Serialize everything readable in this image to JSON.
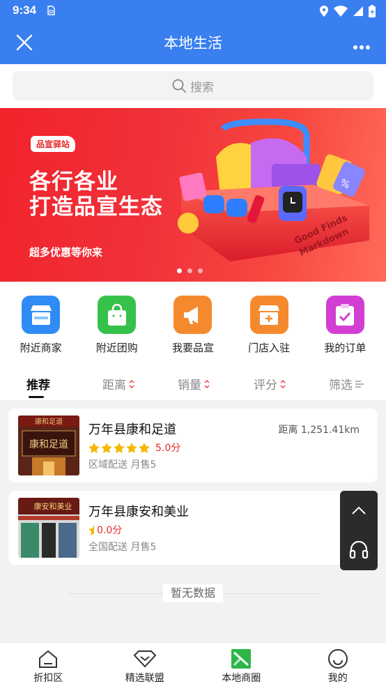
{
  "status_bar": {
    "time": "9:34"
  },
  "header": {
    "title": "本地生活"
  },
  "search": {
    "placeholder": "搜索"
  },
  "banner": {
    "tag": "品宣驿站",
    "headline_1": "各行各业",
    "headline_2": "打造品宣生态",
    "subtitle": "超多优惠等你来",
    "box_text_1": "Good Finds",
    "box_text_2": "Markdown",
    "tag_text": "%"
  },
  "quick_actions": [
    {
      "label": "附近商家",
      "icon": "storefront-icon",
      "color": "#2f8cf5"
    },
    {
      "label": "附近团购",
      "icon": "shopping-bag-icon",
      "color": "#36c24a"
    },
    {
      "label": "我要品宣",
      "icon": "megaphone-icon",
      "color": "#f5892e"
    },
    {
      "label": "门店入驻",
      "icon": "store-join-icon",
      "color": "#f5892e"
    },
    {
      "label": "我的订单",
      "icon": "order-icon",
      "color": "#d23ed4"
    }
  ],
  "sort_tabs": [
    {
      "label": "推荐",
      "active": true
    },
    {
      "label": "距离"
    },
    {
      "label": "销量"
    },
    {
      "label": "评分"
    },
    {
      "label": "筛选"
    }
  ],
  "stores": [
    {
      "name": "万年县康和足道",
      "rating_text": "5.0分",
      "stars": 5,
      "meta": "区域配送 月售5",
      "distance": "距离 1,251.41km",
      "sign_text": "康和足道",
      "sign_top": "康和足道"
    },
    {
      "name": "万年县康安和美业",
      "rating_text": "0.0分",
      "stars": 0,
      "meta": "全国配送 月售5",
      "distance": "",
      "sign_text": "康安和美业"
    }
  ],
  "empty_text": "暂无数据",
  "tab_bar": [
    {
      "label": "折扣区",
      "icon": "home-icon"
    },
    {
      "label": "精选联盟",
      "icon": "diamond-icon"
    },
    {
      "label": "本地商圈",
      "icon": "local-icon",
      "active": true
    },
    {
      "label": "我的",
      "icon": "smiley-icon"
    }
  ],
  "colors": {
    "primary": "#3a7ff0",
    "rating": "#e62a2a",
    "star": "#f5b800",
    "banner_red": "#f0313a"
  }
}
